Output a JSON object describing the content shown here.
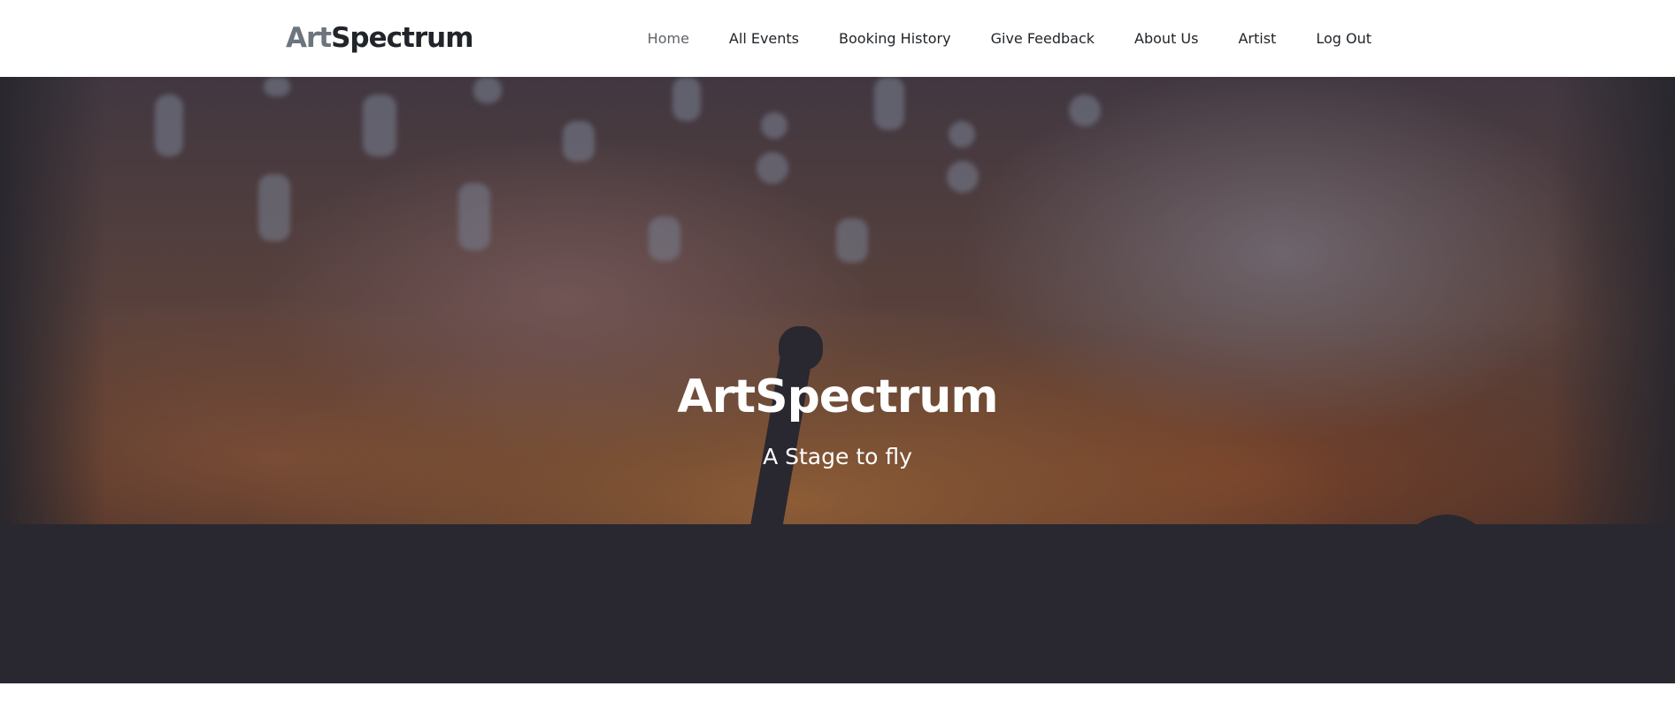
{
  "brand": {
    "part1": "Art",
    "part2": "Spectrum",
    "colors": {
      "part1": "#6c757d",
      "part2": "#212529"
    }
  },
  "nav": {
    "items": [
      {
        "label": "Home",
        "active": true
      },
      {
        "label": "All Events",
        "active": false
      },
      {
        "label": "Booking History",
        "active": false
      },
      {
        "label": "Give Feedback",
        "active": false
      },
      {
        "label": "About Us",
        "active": false
      },
      {
        "label": "Artist",
        "active": false
      },
      {
        "label": "Log Out",
        "active": false
      }
    ]
  },
  "hero": {
    "title": "ArtSpectrum",
    "subtitle": "A Stage to fly",
    "text_color": "#ffffff",
    "background_image": "concert-crowd-stage-lights"
  }
}
